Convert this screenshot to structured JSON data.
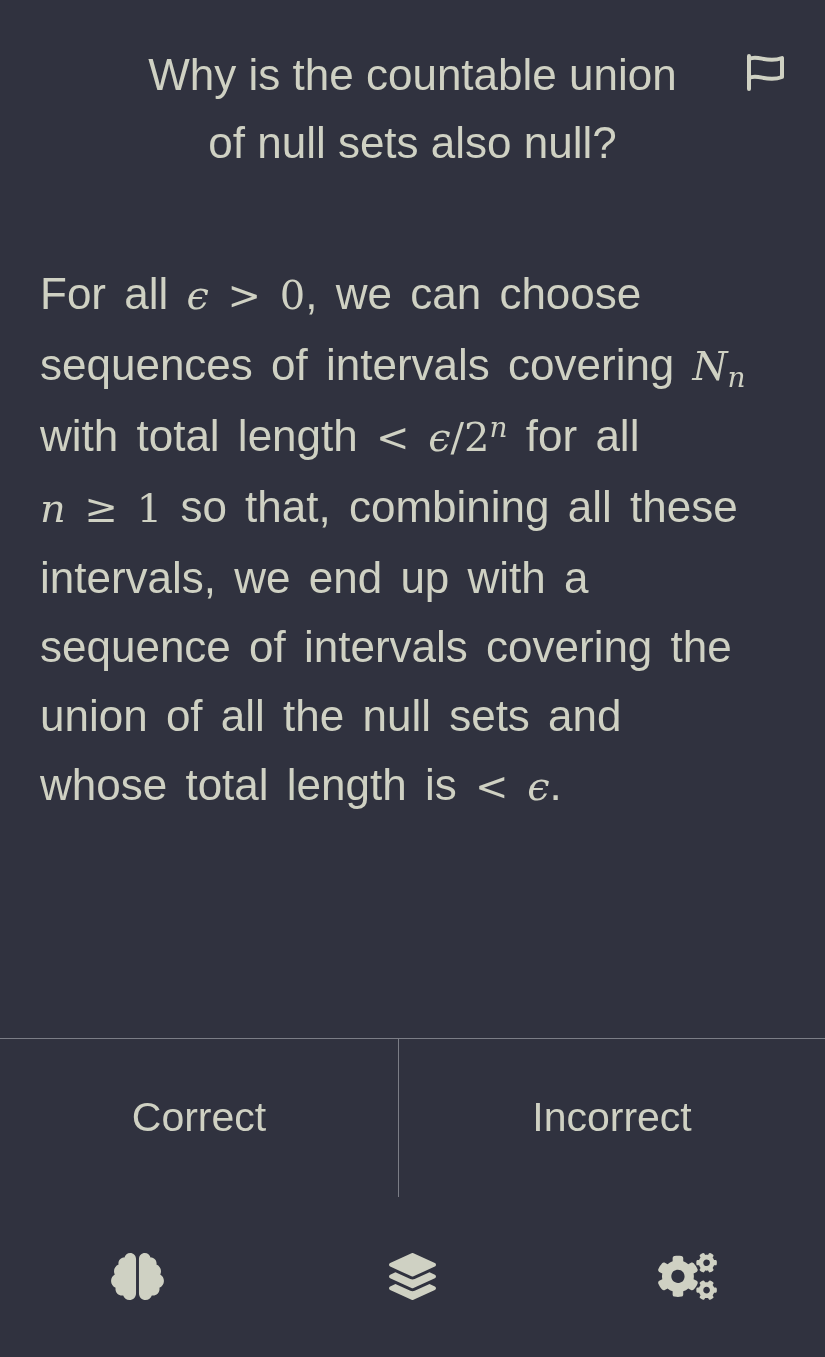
{
  "card": {
    "question": "Why is the countable union of null sets also null?",
    "answer": [
      {
        "kind": "text",
        "text": "For all "
      },
      {
        "kind": "math",
        "text": "*ϵ* > 0"
      },
      {
        "kind": "text",
        "text": ", we can choose sequences of intervals covering "
      },
      {
        "kind": "math",
        "text": "*N*$_{n}$"
      },
      {
        "kind": "text",
        "text": " with total length "
      },
      {
        "kind": "math",
        "text": "< *ϵ*/2$^{n}$"
      },
      {
        "kind": "text",
        "text": " for all "
      },
      {
        "kind": "math",
        "text": "*n* ≥ 1"
      },
      {
        "kind": "text",
        "text": " so that, combining all these intervals, we end up with a sequence of intervals covering the union of all the null sets and whose total length is "
      },
      {
        "kind": "math",
        "text": "< *ϵ*"
      },
      {
        "kind": "text",
        "text": "."
      }
    ]
  },
  "buttons": [
    {
      "label": "Correct"
    },
    {
      "label": "Incorrect"
    }
  ]
}
